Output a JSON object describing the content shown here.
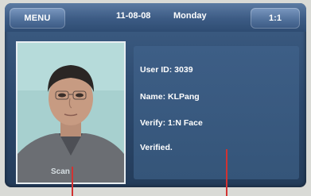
{
  "header": {
    "menu_label": "MENU",
    "date": "11-08-08",
    "day": "Monday",
    "mode_label": "1:1"
  },
  "photo": {
    "scan_label": "Scan"
  },
  "verification": {
    "user_id": "User ID: 3039",
    "name": "Name: KLPang",
    "verify": "Verify: 1:N Face",
    "status": "Verified."
  },
  "colors": {
    "screen_bg": "#2b486c",
    "topbar": "#3c5b84",
    "button": "#4f6f99",
    "text": "#ffffff",
    "pointer": "#d23232"
  }
}
